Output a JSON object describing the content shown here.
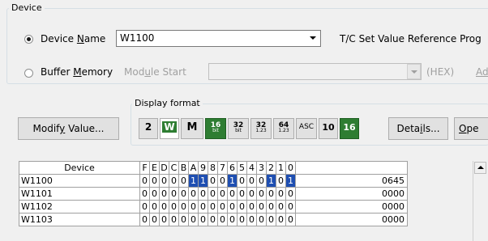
{
  "device_group": {
    "title": "Device",
    "device_name_radio": {
      "label_pre": "Device ",
      "label_u": "N",
      "label_post": "ame",
      "selected": true
    },
    "device_name_value": "W1100",
    "tc_label": "T/C Set Value Reference Prog",
    "buffer_memory_radio": {
      "label_pre": "Buffer ",
      "label_u": "M",
      "label_post": "emory",
      "selected": false
    },
    "module_start": {
      "label_pre": "Mod",
      "label_u": "u",
      "label_post": "le Start"
    },
    "hex_label": "(HEX)",
    "address_label": "Ad"
  },
  "display_format": {
    "title": "Display format",
    "modify_button": {
      "label_pre": "Modif",
      "label_u": "y",
      "label_post": " Value..."
    },
    "buttons": [
      {
        "id": "2",
        "text": "2"
      },
      {
        "id": "w",
        "text": "W"
      },
      {
        "id": "m",
        "text": "M"
      },
      {
        "id": "16bit",
        "text": "16",
        "sub": "bit"
      },
      {
        "id": "32bit",
        "text": "32",
        "sub": "bit"
      },
      {
        "id": "32f",
        "text": "32",
        "sub": "1.23"
      },
      {
        "id": "64f",
        "text": "64",
        "sub": "1.23"
      },
      {
        "id": "asc",
        "text": "ASC"
      },
      {
        "id": "10",
        "text": "10"
      },
      {
        "id": "16",
        "text": "16"
      }
    ],
    "details_button": {
      "label_pre": "Deta",
      "label_u": "i",
      "label_post": "ls..."
    },
    "open_button": {
      "label_pre": "",
      "label_u": "O",
      "label_post": "pe"
    }
  },
  "grid": {
    "device_header": "Device",
    "bit_headers": [
      "F",
      "E",
      "D",
      "C",
      "B",
      "A",
      "9",
      "8",
      "7",
      "6",
      "5",
      "4",
      "3",
      "2",
      "1",
      "0"
    ],
    "rows": [
      {
        "device": "W1100",
        "bits": [
          "0",
          "0",
          "0",
          "0",
          "0",
          "1",
          "1",
          "0",
          "0",
          "1",
          "0",
          "0",
          "0",
          "1",
          "0",
          "1"
        ],
        "value": "0645"
      },
      {
        "device": "W1101",
        "bits": [
          "0",
          "0",
          "0",
          "0",
          "0",
          "0",
          "0",
          "0",
          "0",
          "0",
          "0",
          "0",
          "0",
          "0",
          "0",
          "0"
        ],
        "value": "0000"
      },
      {
        "device": "W1102",
        "bits": [
          "0",
          "0",
          "0",
          "0",
          "0",
          "0",
          "0",
          "0",
          "0",
          "0",
          "0",
          "0",
          "0",
          "0",
          "0",
          "0"
        ],
        "value": "0000"
      },
      {
        "device": "W1103",
        "bits": [
          "0",
          "0",
          "0",
          "0",
          "0",
          "0",
          "0",
          "0",
          "0",
          "0",
          "0",
          "0",
          "0",
          "0",
          "0",
          "0"
        ],
        "value": "0000"
      }
    ]
  },
  "colors": {
    "bit_set_bg": "#1f4fb2",
    "green_button": "#2e7d32"
  }
}
